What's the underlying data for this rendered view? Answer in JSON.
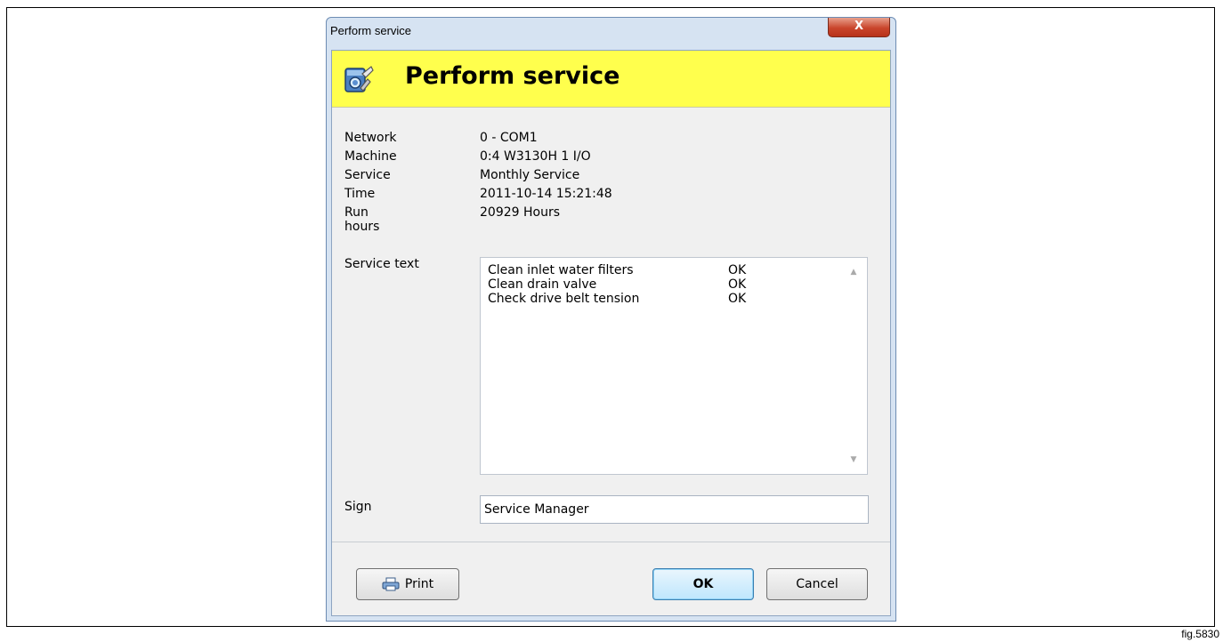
{
  "window": {
    "title": "Perform service",
    "close_glyph": "X"
  },
  "banner": {
    "title": "Perform service",
    "icon": "washing-machine-service-icon"
  },
  "info": [
    {
      "label": "Network",
      "value": "0 - COM1"
    },
    {
      "label": "Machine",
      "value": "0:4 W3130H 1 I/O"
    },
    {
      "label": "Service",
      "value": "Monthly Service"
    },
    {
      "label": "Time",
      "value": "2011-10-14 15:21:48"
    },
    {
      "label": "Run hours",
      "value": "20929 Hours"
    }
  ],
  "service_text": {
    "label": "Service text",
    "lines": [
      {
        "task": "Clean inlet water filters",
        "status": "OK"
      },
      {
        "task": "Clean drain valve",
        "status": "OK"
      },
      {
        "task": "Check drive belt tension",
        "status": "OK"
      }
    ]
  },
  "sign": {
    "label": "Sign",
    "value": "Service Manager"
  },
  "buttons": {
    "print": "Print",
    "ok": "OK",
    "cancel": "Cancel"
  },
  "figure_label": "fig.5830",
  "colors": {
    "banner": "#ffff4d",
    "dialog_bg": "#f0f0f0",
    "frame": "#d6e3f2"
  }
}
